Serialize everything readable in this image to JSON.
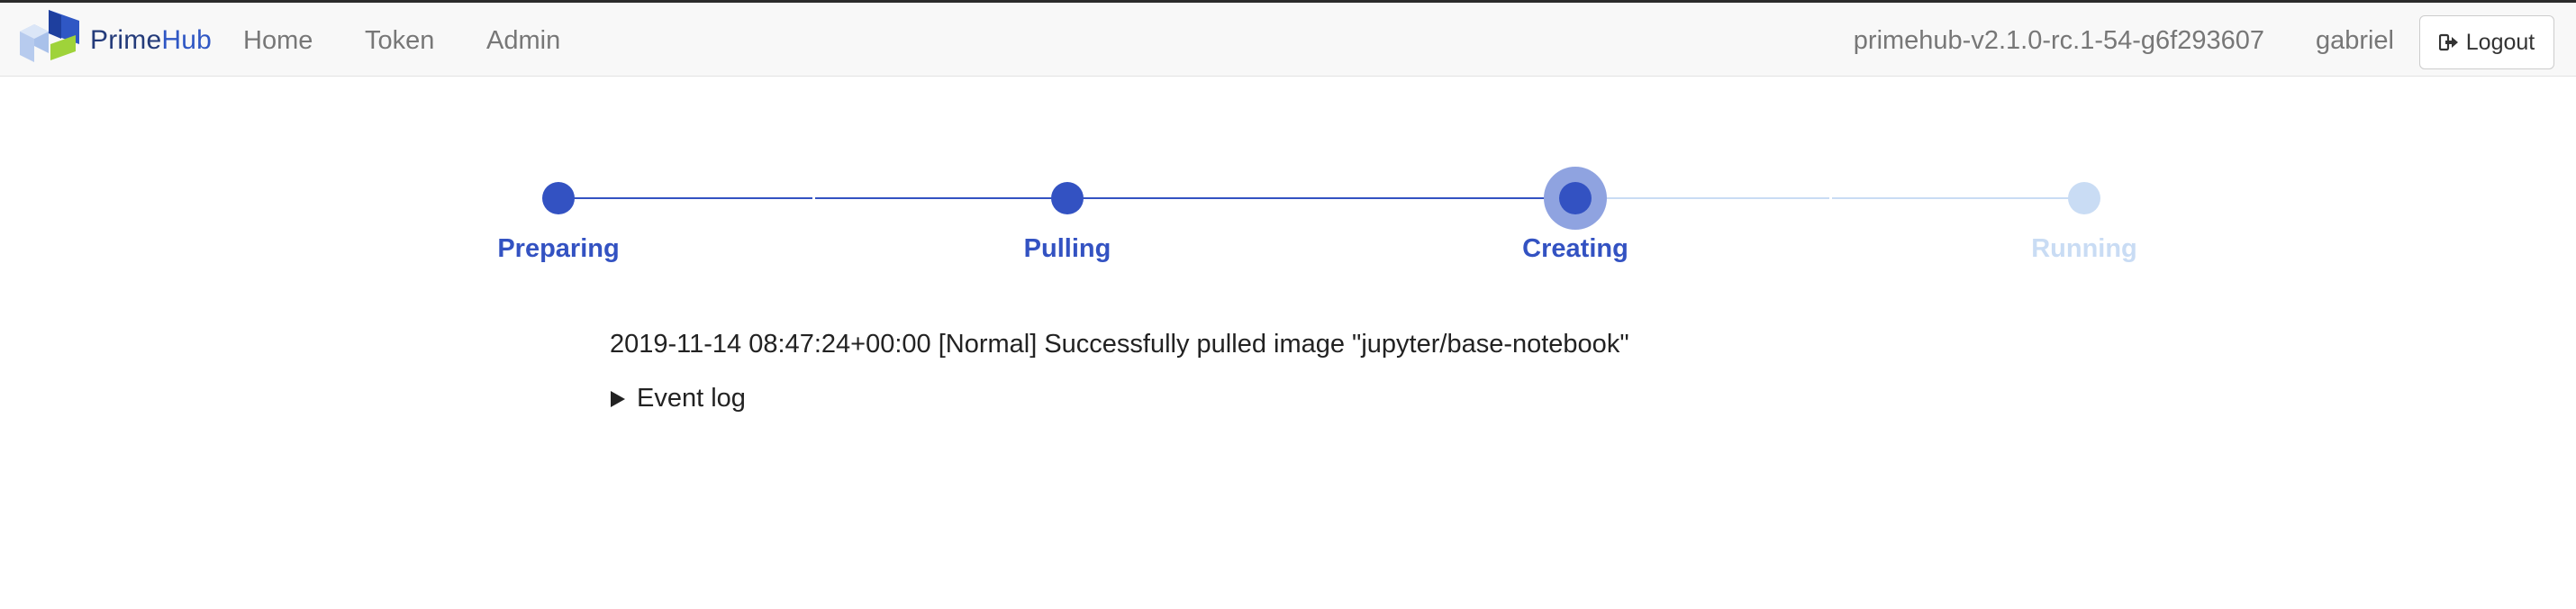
{
  "brand": {
    "name_part1": "Prime",
    "name_part2": "Hub",
    "colors": {
      "dark": "#243b7a",
      "accent": "#2f57c4",
      "cube_light": "#b9cdef",
      "cube_green": "#9fd33a"
    }
  },
  "nav": {
    "links": [
      "Home",
      "Token",
      "Admin"
    ],
    "version": "primehub-v2.1.0-rc.1-54-g6f293607",
    "user": "gabriel",
    "logout_label": "Logout",
    "logout_icon": "sign-out-icon"
  },
  "progress": {
    "steps": [
      {
        "label": "Preparing",
        "status": "done"
      },
      {
        "label": "Pulling",
        "status": "done"
      },
      {
        "label": "Creating",
        "status": "current"
      },
      {
        "label": "Running",
        "status": "pending"
      }
    ],
    "colors": {
      "active": "#3352c2",
      "pending": "#c9dcf4",
      "halo": "#8fa3e0"
    }
  },
  "status_message": "2019-11-14 08:47:24+00:00 [Normal] Successfully pulled image \"jupyter/base-notebook\"",
  "event_log": {
    "label": "Event log",
    "expanded": false,
    "icon": "disclosure-triangle-icon"
  }
}
